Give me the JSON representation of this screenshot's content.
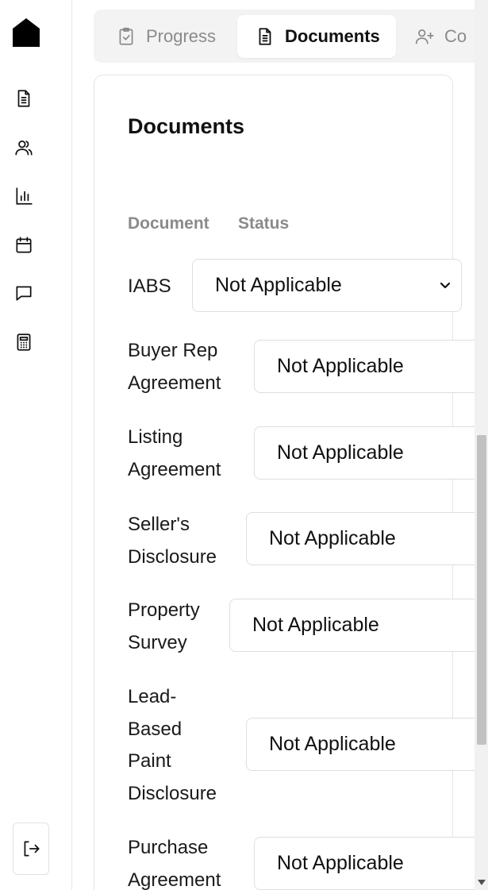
{
  "sidebar": {
    "logo": "home-icon",
    "nav_items": [
      {
        "icon": "document-icon"
      },
      {
        "icon": "users-icon"
      },
      {
        "icon": "bar-chart-icon"
      },
      {
        "icon": "calendar-icon"
      },
      {
        "icon": "chat-icon"
      },
      {
        "icon": "calculator-icon"
      }
    ],
    "logout_icon": "logout-icon"
  },
  "tabs": [
    {
      "label": "Progress",
      "icon": "clipboard-check-icon",
      "active": false
    },
    {
      "label": "Documents",
      "icon": "document-icon",
      "active": true
    },
    {
      "label": "Co",
      "icon": "user-plus-icon",
      "active": false
    }
  ],
  "documents": {
    "title": "Documents",
    "columns": {
      "document": "Document",
      "status": "Status"
    },
    "rows": [
      {
        "name_lines": [
          "IABS"
        ],
        "status": "Not Applicable"
      },
      {
        "name_lines": [
          "Buyer Rep",
          "Agreement"
        ],
        "status": "Not Applicable"
      },
      {
        "name_lines": [
          "Listing",
          "Agreement"
        ],
        "status": "Not Applicable"
      },
      {
        "name_lines": [
          "Seller's",
          "Disclosure"
        ],
        "status": "Not Applicable"
      },
      {
        "name_lines": [
          "Property",
          "Survey"
        ],
        "status": "Not Applicable"
      },
      {
        "name_lines": [
          "Lead-",
          "Based",
          "Paint",
          "Disclosure"
        ],
        "status": "Not Applicable"
      },
      {
        "name_lines": [
          "Purchase",
          "Agreement"
        ],
        "status": "Not Applicable"
      }
    ]
  },
  "colors": {
    "tab_bar_bg": "#f3f3f3",
    "muted_text": "#8a8a8a",
    "border": "#e5e5e5"
  }
}
